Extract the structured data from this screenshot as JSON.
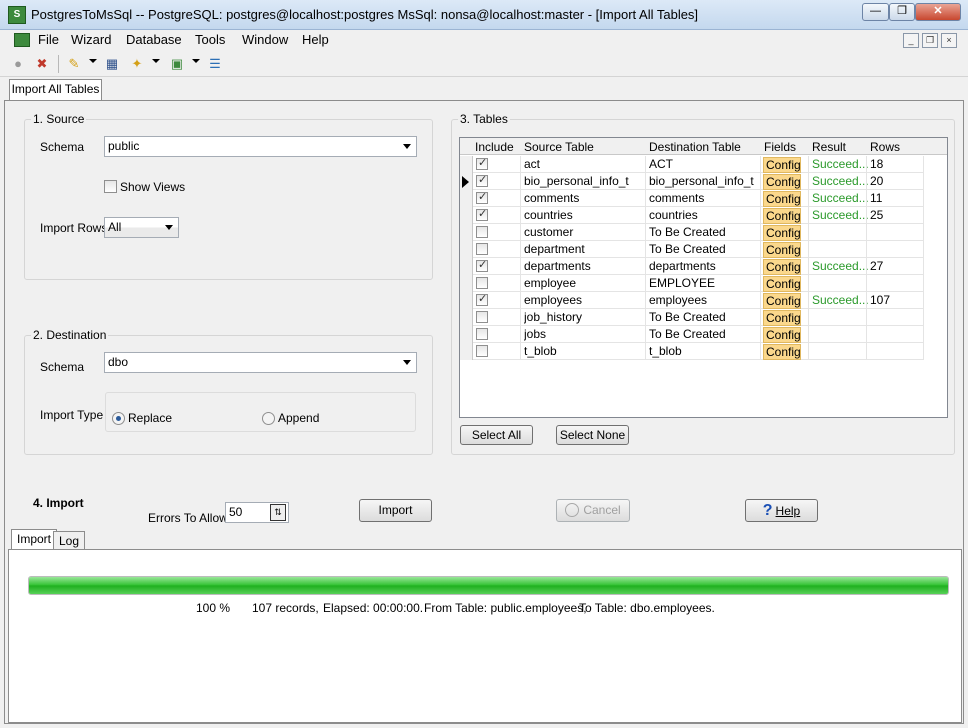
{
  "window": {
    "title": "PostgresToMsSql -- PostgreSQL: postgres@localhost:postgres MsSql: nonsa@localhost:master - [Import All Tables]",
    "app_icon_text": "S",
    "minimize": "—",
    "restore": "❐",
    "close": "✕"
  },
  "menu": {
    "items": [
      "File",
      "Wizard",
      "Database",
      "Tools",
      "Window",
      "Help"
    ],
    "mdi_minimize": "_",
    "mdi_restore": "❐",
    "mdi_close": "×"
  },
  "toolbar": {
    "icons": [
      "connect-icon",
      "disconnect-icon",
      "wizard-icon",
      "query-icon",
      "tools-icon",
      "window-icon",
      "list-icon"
    ]
  },
  "doc_tab": {
    "label": "Import All Tables"
  },
  "source": {
    "title": "1. Source",
    "schema_label": "Schema",
    "schema_value": "public",
    "show_views_label": "Show Views",
    "import_rows_label": "Import Rows",
    "import_rows_value": "All"
  },
  "destination": {
    "title": "2. Destination",
    "schema_label": "Schema",
    "schema_value": "dbo",
    "import_type_label": "Import Type",
    "replace_label": "Replace",
    "append_label": "Append"
  },
  "tables": {
    "title": "3. Tables",
    "columns": [
      "Include",
      "Source Table",
      "Destination Table",
      "Fields",
      "Result",
      "Rows"
    ],
    "rows": [
      {
        "include": true,
        "source": "act",
        "dest": "ACT",
        "fields": "Config",
        "result": "Succeed...",
        "rows": "18"
      },
      {
        "include": true,
        "source": "bio_personal_info_t",
        "dest": "bio_personal_info_t",
        "fields": "Config",
        "result": "Succeed...",
        "rows": "20"
      },
      {
        "include": true,
        "source": "comments",
        "dest": "comments",
        "fields": "Config",
        "result": "Succeed...",
        "rows": "11"
      },
      {
        "include": true,
        "source": "countries",
        "dest": "countries",
        "fields": "Config",
        "result": "Succeed...",
        "rows": "25"
      },
      {
        "include": false,
        "source": "customer",
        "dest": "To Be Created",
        "fields": "Config",
        "result": "",
        "rows": ""
      },
      {
        "include": false,
        "source": "department",
        "dest": "To Be Created",
        "fields": "Config",
        "result": "",
        "rows": ""
      },
      {
        "include": true,
        "source": "departments",
        "dest": "departments",
        "fields": "Config",
        "result": "Succeed...",
        "rows": "27"
      },
      {
        "include": false,
        "source": "employee",
        "dest": "EMPLOYEE",
        "fields": "Config",
        "result": "",
        "rows": ""
      },
      {
        "include": true,
        "source": "employees",
        "dest": "employees",
        "fields": "Config",
        "result": "Succeed...",
        "rows": "107"
      },
      {
        "include": false,
        "source": "job_history",
        "dest": "To Be Created",
        "fields": "Config",
        "result": "",
        "rows": ""
      },
      {
        "include": false,
        "source": "jobs",
        "dest": "To Be Created",
        "fields": "Config",
        "result": "",
        "rows": ""
      },
      {
        "include": false,
        "source": "t_blob",
        "dest": "t_blob",
        "fields": "Config",
        "result": "",
        "rows": ""
      }
    ],
    "select_all": "Select All",
    "select_none": "Select None"
  },
  "import": {
    "title": "4. Import",
    "errors_label": "Errors To Allow",
    "errors_value": "50",
    "import_button": "Import",
    "cancel_button": "Cancel",
    "help_button": "Help"
  },
  "bottom_tabs": [
    "Import",
    "Log"
  ],
  "progress": {
    "fraction": 1.0,
    "percent": "100 %",
    "records": "107 records,",
    "elapsed": "Elapsed: 00:00:00.",
    "from_table": "From Table: public.employees,",
    "to_table": "To Table: dbo.employees."
  },
  "colors": {
    "config_bg": "#fbd88c",
    "result_text": "#2b9a2b",
    "progress": "#2fc12f"
  }
}
